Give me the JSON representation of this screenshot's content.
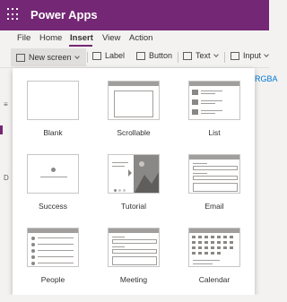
{
  "app": {
    "title": "Power Apps"
  },
  "menu": {
    "items": [
      "File",
      "Home",
      "Insert",
      "View",
      "Action"
    ],
    "active": "Insert"
  },
  "toolbar": {
    "new_screen": "New screen",
    "label": "Label",
    "button": "Button",
    "text": "Text",
    "input": "Input"
  },
  "side": {
    "rgba_partial": "RGBA"
  },
  "templates": [
    {
      "name": "Blank"
    },
    {
      "name": "Scrollable"
    },
    {
      "name": "List"
    },
    {
      "name": "Success"
    },
    {
      "name": "Tutorial"
    },
    {
      "name": "Email"
    },
    {
      "name": "People"
    },
    {
      "name": "Meeting"
    },
    {
      "name": "Calendar"
    }
  ],
  "colors": {
    "titlebar": "#742774",
    "accent": "#742774",
    "link": "#0078d4"
  }
}
